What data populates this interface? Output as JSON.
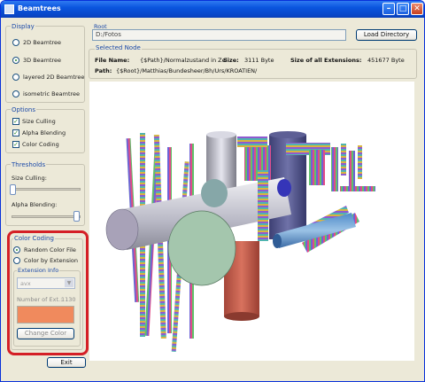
{
  "window": {
    "title": "Beamtrees"
  },
  "display": {
    "title": "Display",
    "options": [
      {
        "label": "2D Beamtree",
        "selected": false
      },
      {
        "label": "3D Beamtree",
        "selected": true
      },
      {
        "label": "layered 2D Beamtree",
        "selected": false
      },
      {
        "label": "isometric Beamtree",
        "selected": false
      }
    ]
  },
  "options": {
    "title": "Options",
    "items": [
      {
        "label": "Size Culling",
        "checked": true
      },
      {
        "label": "Alpha Blending",
        "checked": true
      },
      {
        "label": "Color Coding",
        "checked": true
      }
    ]
  },
  "thresholds": {
    "title": "Thresholds",
    "size_label": "Size Culling:",
    "alpha_label": "Alpha Blending:",
    "size_value": 0.0,
    "alpha_value": 0.9
  },
  "color_coding": {
    "title": "Color Coding",
    "random_label": "Random Color File",
    "by_ext_label": "Color by Extension",
    "random_selected": true,
    "ext_info_title": "Extension Info",
    "ext_dropdown_value": "avx",
    "num_ext_label": "Number of Ext.:",
    "num_ext_value": "1130",
    "swatch_color": "#f08a5d",
    "change_color_label": "Change Color"
  },
  "exit_label": "Exit",
  "root": {
    "label": "Root",
    "value": "D:/Fotos",
    "load_button": "Load Directory"
  },
  "selected_node": {
    "title": "Selected Node",
    "file_name_label": "File Name:",
    "file_name_value": "{$Path}/Normalzustand in Zel",
    "size_label": "Size:",
    "size_value": "3111 Byte",
    "size_all_label": "Size of all Extensions:",
    "size_all_value": "451677 Byte",
    "path_label": "Path:",
    "path_value": "{$Root}/Matthias/Bundesheer/Bh/Urs/KROATIEN/"
  },
  "visualization": {
    "alt": "3D beamtree visualization"
  }
}
